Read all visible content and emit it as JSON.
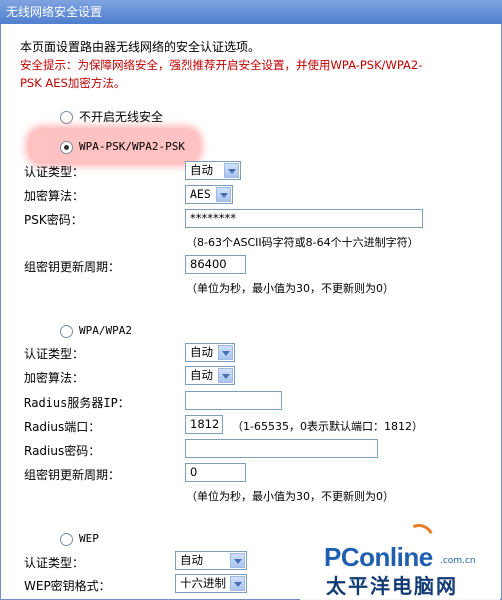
{
  "window": {
    "title": "无线网络安全设置"
  },
  "intro": {
    "description": "本页面设置路由器无线网络的安全认证选项。",
    "tip_line1": "安全提示：为保障网络安全，强烈推荐开启安全设置，并使用WPA-PSK/WPA2-",
    "tip_line2": "PSK AES加密方法。"
  },
  "options": {
    "no_security": "不开启无线安全",
    "wpa_psk": {
      "label": "WPA-PSK/WPA2-PSK",
      "auth_type_label": "认证类型：",
      "auth_type_value": "自动",
      "encryption_label": "加密算法：",
      "encryption_value": "AES",
      "psk_label": "PSK密码：",
      "psk_value": "********",
      "psk_hint": "（8-63个ASCII码字符或8-64个十六进制字符）",
      "group_key_label": "组密钥更新周期：",
      "group_key_value": "86400",
      "group_key_hint": "（单位为秒，最小值为30，不更新则为0）"
    },
    "wpa": {
      "label": "WPA/WPA2",
      "auth_type_label": "认证类型：",
      "auth_type_value": "自动",
      "encryption_label": "加密算法：",
      "encryption_value": "自动",
      "radius_ip_label": "Radius服务器IP：",
      "radius_ip_value": "",
      "radius_port_label": "Radius端口：",
      "radius_port_value": "1812",
      "radius_port_hint": "（1-65535，0表示默认端口：1812）",
      "radius_pwd_label": "Radius密码：",
      "radius_pwd_value": "",
      "group_key_label": "组密钥更新周期：",
      "group_key_value": "0",
      "group_key_hint": "（单位为秒，最小值为30，不更新则为0）"
    },
    "wep": {
      "label": "WEP",
      "auth_type_label": "认证类型：",
      "auth_type_value": "自动",
      "key_format_label": "WEP密钥格式：",
      "key_format_value": "十六进制"
    }
  },
  "watermark": {
    "brand": "PConline",
    "domain": ".com.cn",
    "cn_name": "太平洋电脑网"
  }
}
